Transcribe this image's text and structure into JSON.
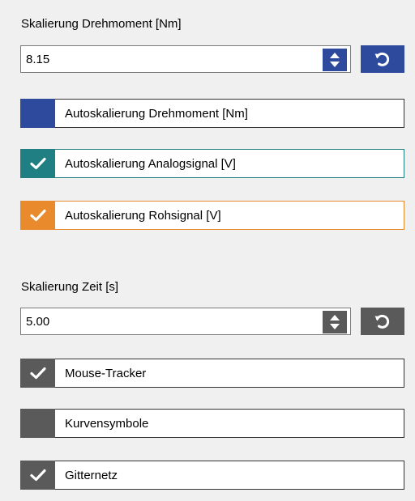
{
  "torque": {
    "section_label": "Skalierung Drehmoment [Nm]",
    "value": "8.15",
    "spin_color": "#2e4a9c",
    "reset_color": "#2e4a9c"
  },
  "auto_scale": [
    {
      "label": "Autoskalierung Drehmoment [Nm]",
      "checked": false,
      "color": "#2e4a9c"
    },
    {
      "label": "Autoskalierung Analogsignal [V]",
      "checked": true,
      "color": "#1f7f82"
    },
    {
      "label": "Autoskalierung Rohsignal [V]",
      "checked": true,
      "color": "#e98a2c"
    }
  ],
  "time": {
    "section_label": "Skalierung Zeit [s]",
    "value": "5.00",
    "spin_color": "#5a5a5a",
    "reset_color": "#5a5a5a"
  },
  "display_options": [
    {
      "label": "Mouse-Tracker",
      "checked": true,
      "color": "#5a5a5a"
    },
    {
      "label": "Kurvensymbole",
      "checked": false,
      "color": "#5a5a5a"
    },
    {
      "label": "Gitternetz",
      "checked": true,
      "color": "#5a5a5a"
    }
  ],
  "icons": {
    "spin": "up-down-arrows-icon",
    "reset": "reset-icon",
    "check": "checkmark-icon"
  }
}
